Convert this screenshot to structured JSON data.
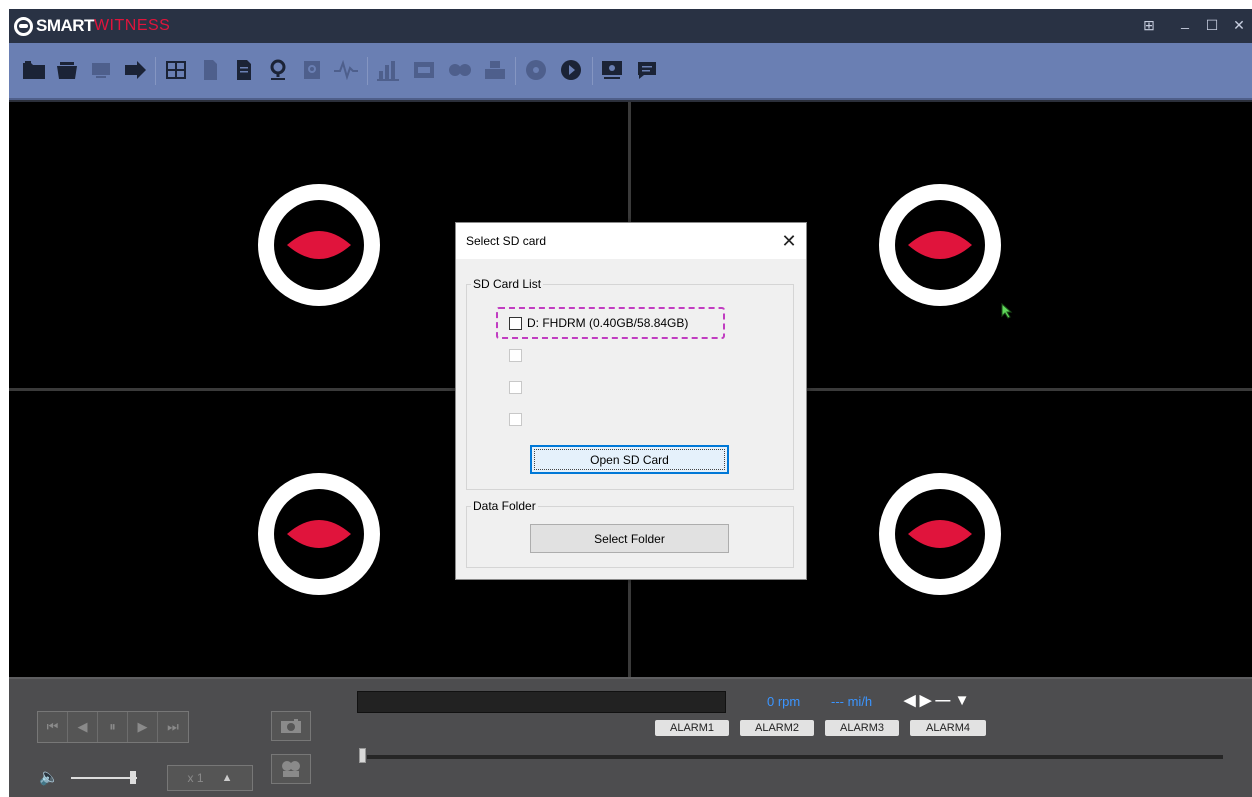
{
  "app": {
    "logo_primary": "SMART",
    "logo_secondary": "WITNESS",
    "window_controls": {
      "layout": "⊞",
      "minimize": "_",
      "maximize": "☐",
      "close": "✕"
    }
  },
  "toolbar": {
    "items": [
      {
        "name": "open-folder-icon",
        "dim": false
      },
      {
        "name": "open-file-icon",
        "dim": false
      },
      {
        "name": "monitor-icon",
        "dim": true
      },
      {
        "name": "export-icon",
        "dim": false
      },
      {
        "name": "grid-layout-icon",
        "dim": false
      },
      {
        "name": "document-icon",
        "dim": true
      },
      {
        "name": "report-icon",
        "dim": false
      },
      {
        "name": "map-pin-icon",
        "dim": false
      },
      {
        "name": "search-doc-icon",
        "dim": true
      },
      {
        "name": "waveform-icon",
        "dim": true
      },
      {
        "name": "signal-bars-icon",
        "dim": true
      },
      {
        "name": "card-reader-icon",
        "dim": true
      },
      {
        "name": "film-reel-icon",
        "dim": true
      },
      {
        "name": "printer-icon",
        "dim": true
      },
      {
        "name": "disc-icon",
        "dim": true
      },
      {
        "name": "play-circle-icon",
        "dim": false
      },
      {
        "name": "settings-monitor-icon",
        "dim": false
      },
      {
        "name": "chat-icon",
        "dim": false
      }
    ]
  },
  "dialog": {
    "title": "Select SD card",
    "close_label": "✕",
    "sd_group_label": "SD Card List",
    "sd_cards": [
      {
        "label": "D:  FHDRM (0.40GB/58.84GB)",
        "checked": false
      },
      {
        "label": "",
        "checked": false
      },
      {
        "label": "",
        "checked": false
      },
      {
        "label": "",
        "checked": false
      }
    ],
    "open_button": "Open SD Card",
    "folder_group_label": "Data Folder",
    "select_folder_button": "Select Folder"
  },
  "controls": {
    "rpm": "0 rpm",
    "speed": "--- mi/h",
    "indicators": "◀ ▶ — ▼",
    "alarms": [
      "ALARM1",
      "ALARM2",
      "ALARM3",
      "ALARM4"
    ],
    "playback_speed": "x 1",
    "speed_arrow": "▲",
    "playback_buttons": [
      "⏮",
      "◀",
      "⏸",
      "▶",
      "⏭"
    ],
    "volume_icon": "🔈"
  },
  "colors": {
    "accent_red": "#e0143c",
    "toolbar_bg": "#6a7fb3",
    "titlebar_bg": "#293244",
    "status_blue": "#3b95ff",
    "highlight": "#c13dc1"
  }
}
